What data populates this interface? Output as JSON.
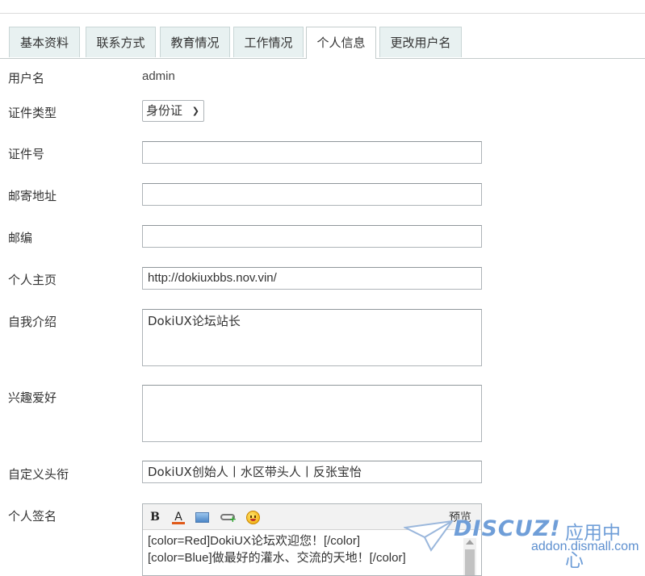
{
  "tabs": [
    {
      "label": "基本资料",
      "active": false
    },
    {
      "label": "联系方式",
      "active": false
    },
    {
      "label": "教育情况",
      "active": false
    },
    {
      "label": "工作情况",
      "active": false
    },
    {
      "label": "个人信息",
      "active": true
    },
    {
      "label": "更改用户名",
      "active": false
    }
  ],
  "form": {
    "username": {
      "label": "用户名",
      "value": "admin"
    },
    "id_type": {
      "label": "证件类型",
      "value": "身份证"
    },
    "id_number": {
      "label": "证件号",
      "value": ""
    },
    "mail_address": {
      "label": "邮寄地址",
      "value": ""
    },
    "zipcode": {
      "label": "邮编",
      "value": ""
    },
    "homepage": {
      "label": "个人主页",
      "value": "http://dokiuxbbs.nov.vin/"
    },
    "bio": {
      "label": "自我介绍",
      "value": "DokiUX论坛站长"
    },
    "interests": {
      "label": "兴趣爱好",
      "value": ""
    },
    "custom_title": {
      "label": "自定义头衔",
      "value": "DokiUX创始人丨水区带头人丨反张宝怡"
    },
    "signature": {
      "label": "个人签名",
      "preview_label": "预览",
      "lines": [
        "[color=Red]DokiUX论坛欢迎您！[/color]",
        "[color=Blue]做最好的灌水、交流的天地！[/color]"
      ]
    }
  },
  "toolbar_icons": {
    "bold": "B",
    "font_color": "A",
    "image": "image-icon",
    "link": "link-icon",
    "emoticon": "smiley-icon"
  },
  "watermark": {
    "brand": "DISCUZ!",
    "cn": "应用中心",
    "url": "addon.dismall.com"
  },
  "colors": {
    "tab_bg": "#e8f1f1",
    "accent_blue": "#6f9ed8"
  }
}
